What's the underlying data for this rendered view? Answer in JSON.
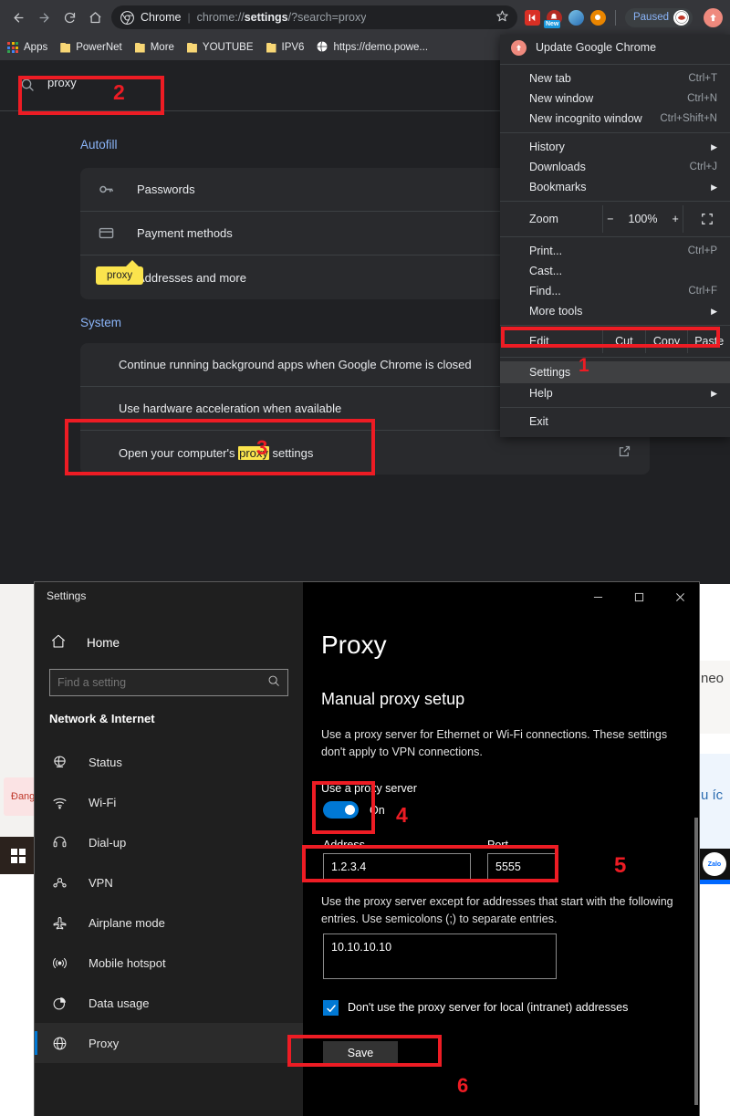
{
  "browser": {
    "nav": {
      "back": "back-arrow",
      "forward": "forward-arrow",
      "reload": "reload",
      "home": "home"
    },
    "omnibox": {
      "chip": "Chrome",
      "url_prefix": "chrome://",
      "url_bold": "settings",
      "url_suffix": "/?search=proxy",
      "star": "★"
    },
    "toolbar": {
      "paused_label": "Paused",
      "extension_badge": "New"
    },
    "bookmarks": [
      {
        "label": "Apps",
        "icon": "apps-grid-icon"
      },
      {
        "label": "PowerNet",
        "icon": "folder-icon"
      },
      {
        "label": "More",
        "icon": "folder-icon"
      },
      {
        "label": "YOUTUBE",
        "icon": "folder-icon"
      },
      {
        "label": "IPV6",
        "icon": "folder-icon"
      },
      {
        "label": "https://demo.powe...",
        "icon": "globe-icon"
      }
    ]
  },
  "chrome_settings": {
    "search": {
      "value": "proxy",
      "icon": "search-icon"
    },
    "autofill": {
      "title": "Autofill",
      "rows": [
        {
          "label": "Passwords",
          "icon": "key-icon"
        },
        {
          "label": "Payment methods",
          "icon": "card-icon"
        },
        {
          "label": "Addresses and more",
          "icon": "location-pin-icon"
        }
      ]
    },
    "system": {
      "title": "System",
      "rows": [
        {
          "label": "Continue running background apps when Google Chrome is closed",
          "control": "none"
        },
        {
          "label": "Use hardware acceleration when available",
          "control": "toggle-on"
        },
        {
          "label_pre": "Open your computer's ",
          "label_mark": "proxy",
          "label_post": " settings",
          "control": "external-link"
        }
      ]
    },
    "tooltip": "proxy"
  },
  "chrome_menu": {
    "update": "Update Google Chrome",
    "groups": [
      [
        {
          "label": "New tab",
          "accel": "Ctrl+T"
        },
        {
          "label": "New window",
          "accel": "Ctrl+N"
        },
        {
          "label": "New incognito window",
          "accel": "Ctrl+Shift+N"
        }
      ],
      [
        {
          "label": "History",
          "accel": "",
          "submenu": true
        },
        {
          "label": "Downloads",
          "accel": "Ctrl+J"
        },
        {
          "label": "Bookmarks",
          "accel": "",
          "submenu": true
        }
      ]
    ],
    "zoom": {
      "label": "Zoom",
      "minus": "−",
      "value": "100%",
      "plus": "+",
      "fullscreen": "fullscreen-icon"
    },
    "group3": [
      {
        "label": "Print...",
        "accel": "Ctrl+P"
      },
      {
        "label": "Cast...",
        "accel": ""
      },
      {
        "label": "Find...",
        "accel": "Ctrl+F"
      },
      {
        "label": "More tools",
        "accel": "",
        "submenu": true
      }
    ],
    "edit_row": {
      "label": "Edit",
      "cut": "Cut",
      "copy": "Copy",
      "paste": "Paste"
    },
    "settings": "Settings",
    "help": "Help",
    "exit": "Exit"
  },
  "annotations": {
    "accent": "#ed1c24",
    "markers": [
      {
        "id": "1",
        "target": "chrome-menu-settings"
      },
      {
        "id": "2",
        "target": "chrome-settings-search"
      },
      {
        "id": "3",
        "target": "open-computer-proxy-settings"
      },
      {
        "id": "4",
        "target": "use-proxy-server-toggle"
      },
      {
        "id": "5",
        "target": "address-port-fields"
      },
      {
        "id": "6",
        "target": "save-button"
      }
    ]
  },
  "windows_settings": {
    "titlebar": {
      "title": "Settings",
      "minimize": "−",
      "maximize": "▢",
      "close": "✕"
    },
    "home": "Home",
    "search_placeholder": "Find a setting",
    "category": "Network & Internet",
    "nav_items": [
      {
        "label": "Status",
        "icon": "globe-status-icon",
        "selected": false
      },
      {
        "label": "Wi-Fi",
        "icon": "wifi-icon",
        "selected": false
      },
      {
        "label": "Dial-up",
        "icon": "dialup-icon",
        "selected": false
      },
      {
        "label": "VPN",
        "icon": "vpn-icon",
        "selected": false
      },
      {
        "label": "Airplane mode",
        "icon": "airplane-icon",
        "selected": false
      },
      {
        "label": "Mobile hotspot",
        "icon": "hotspot-icon",
        "selected": false
      },
      {
        "label": "Data usage",
        "icon": "pie-chart-icon",
        "selected": false
      },
      {
        "label": "Proxy",
        "icon": "globe-icon",
        "selected": true
      }
    ],
    "page_title": "Proxy",
    "section_title": "Manual proxy setup",
    "description": "Use a proxy server for Ethernet or Wi-Fi connections. These settings don't apply to VPN connections.",
    "toggle_label": "Use a proxy server",
    "toggle_state": "On",
    "address_label": "Address",
    "address_value": "1.2.3.4",
    "port_label": "Port",
    "port_value": "5555",
    "exceptions_description": "Use the proxy server except for addresses that start with the following entries. Use semicolons (;) to separate entries.",
    "exceptions_value": "10.10.10.10",
    "checkbox_label": "Don't use the proxy server for local (intranet) addresses",
    "checkbox_checked": true,
    "save_label": "Save"
  },
  "desktop": {
    "pink_note": "Đang",
    "bg_text_1": "neo",
    "bg_text_2": "u íc",
    "zalo_label": "Zalo",
    "start_icon": "windows-logo-icon"
  }
}
